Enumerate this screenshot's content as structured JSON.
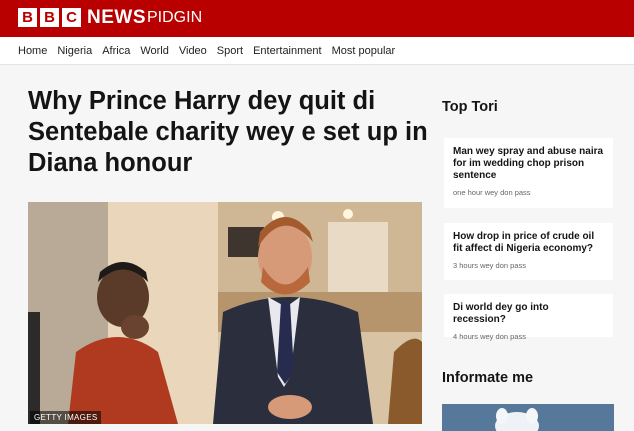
{
  "header": {
    "logo_letters": [
      "B",
      "B",
      "C"
    ],
    "news_label": "NEWS",
    "service_label": "PIDGIN",
    "brand_color": "#b80000"
  },
  "nav": {
    "items": [
      "Home",
      "Nigeria",
      "Africa",
      "World",
      "Video",
      "Sport",
      "Entertainment",
      "Most popular"
    ]
  },
  "article": {
    "headline": "Why Prince Harry dey quit di Sentebale charity wey e set up in Diana honour",
    "image_credit": "GETTY IMAGES"
  },
  "top_tori": {
    "title": "Top Tori",
    "stories": [
      {
        "title": "Man wey spray and abuse naira for im wedding chop prison sentence",
        "time": "one hour wey don pass"
      },
      {
        "title": "How drop in price of crude oil fit affect di Nigeria economy?",
        "time": "3 hours wey don pass"
      },
      {
        "title": "Di world dey go into recession?",
        "time": "4 hours wey don pass"
      }
    ]
  },
  "informate": {
    "title": "Informate me"
  }
}
